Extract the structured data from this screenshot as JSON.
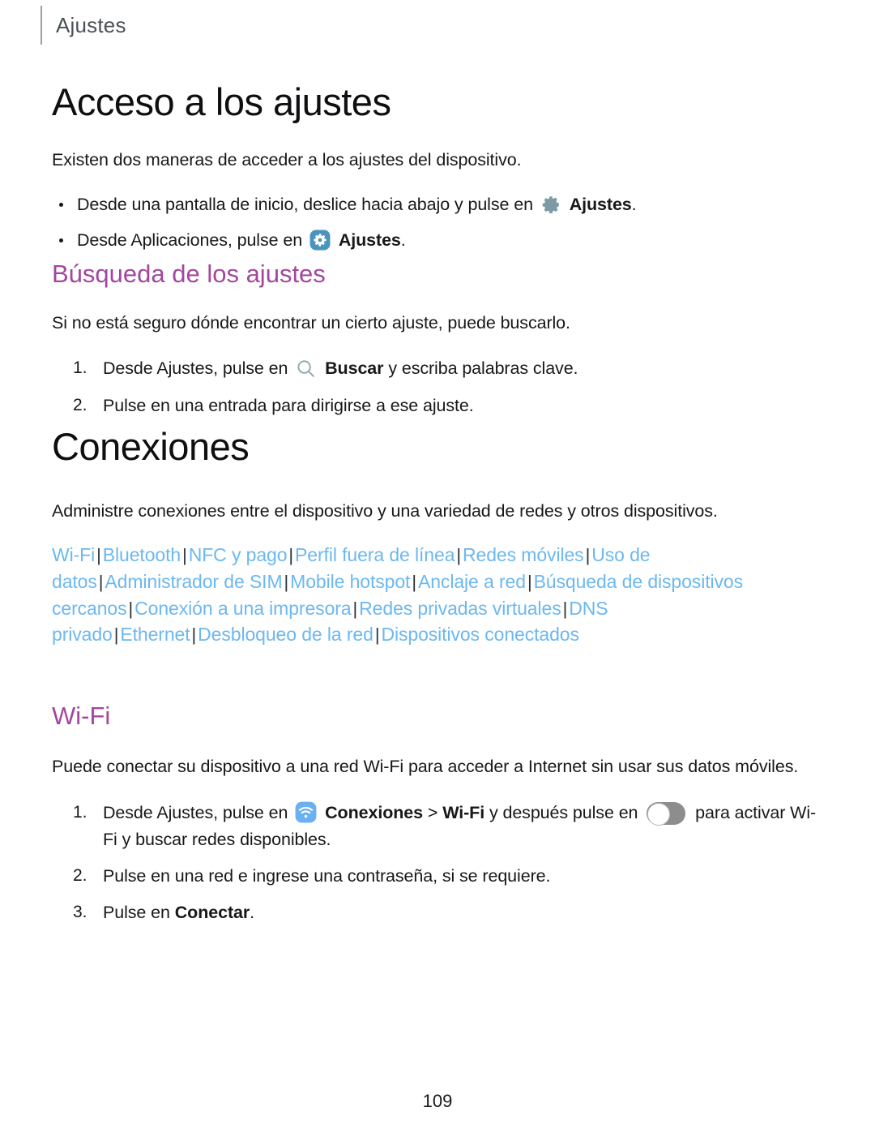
{
  "header": {
    "title": "Ajustes"
  },
  "sections": {
    "acceso": {
      "title": "Acceso a los ajustes",
      "intro": "Existen dos maneras de acceder a los ajustes del dispositivo.",
      "bullets": [
        {
          "pre": "Desde una pantalla de inicio, deslice hacia abajo y pulse en",
          "icon": "gear-gray-icon",
          "bold": "Ajustes",
          "post": "."
        },
        {
          "pre": "Desde Aplicaciones, pulse en",
          "icon": "gear-blue-icon",
          "bold": "Ajustes",
          "post": "."
        }
      ]
    },
    "busqueda": {
      "title": "Búsqueda de los ajustes",
      "intro": "Si no está seguro dónde encontrar un cierto ajuste, puede buscarlo.",
      "steps": [
        {
          "pre": "Desde Ajustes, pulse en",
          "icon": "search-icon",
          "bold": "Buscar",
          "post": "y escriba palabras clave."
        },
        {
          "pre": "Pulse en una entrada para dirigirse a ese ajuste.",
          "icon": "",
          "bold": "",
          "post": ""
        }
      ]
    },
    "conexiones": {
      "title": "Conexiones",
      "intro": "Administre conexiones entre el dispositivo y una variedad de redes y otros dispositivos.",
      "links": [
        "Wi-Fi",
        "Bluetooth",
        "NFC y pago",
        "Perfil fuera de línea",
        "Redes móviles",
        "Uso de datos",
        "Administrador de SIM",
        "Mobile hotspot",
        "Anclaje a red",
        "Búsqueda de dispositivos cercanos",
        "Conexión a una impresora",
        "Redes privadas virtuales",
        "DNS privado",
        "Ethernet",
        "Desbloqueo de la red",
        "Dispositivos conectados"
      ],
      "link_separator": "|"
    },
    "wifi": {
      "title": "Wi-Fi",
      "intro": "Puede conectar su dispositivo a una red Wi-Fi para acceder a Internet sin usar sus datos móviles.",
      "steps": [
        {
          "pre": "Desde Ajustes, pulse en",
          "icon": "wifi-blue-icon",
          "bold": "Conexiones",
          "mid": ">",
          "bold2": "Wi-Fi",
          "mid2": "y después pulse en",
          "toggle": "wifi-toggle-off",
          "post": "para activar Wi-Fi y buscar redes disponibles."
        },
        {
          "pre": "Pulse en una red e ingrese una contraseña, si se requiere.",
          "icon": "",
          "bold": "",
          "post": ""
        },
        {
          "pre": "Pulse en",
          "icon": "",
          "bold": "Conectar",
          "post": "."
        }
      ]
    }
  },
  "footer": {
    "page_number": "109"
  },
  "colors": {
    "heading_purple": "#a3479e",
    "link_blue": "#6cb8f0",
    "gear_gray": "#7e9aa4",
    "gear_blue_bg": "#4a94bd",
    "wifi_blue_bg": "#6ab0f3",
    "search_icon": "#93a7ae",
    "toggle_track": "#8d8d8d",
    "header_gray": "#4a5156",
    "body_black": "#17181a"
  }
}
